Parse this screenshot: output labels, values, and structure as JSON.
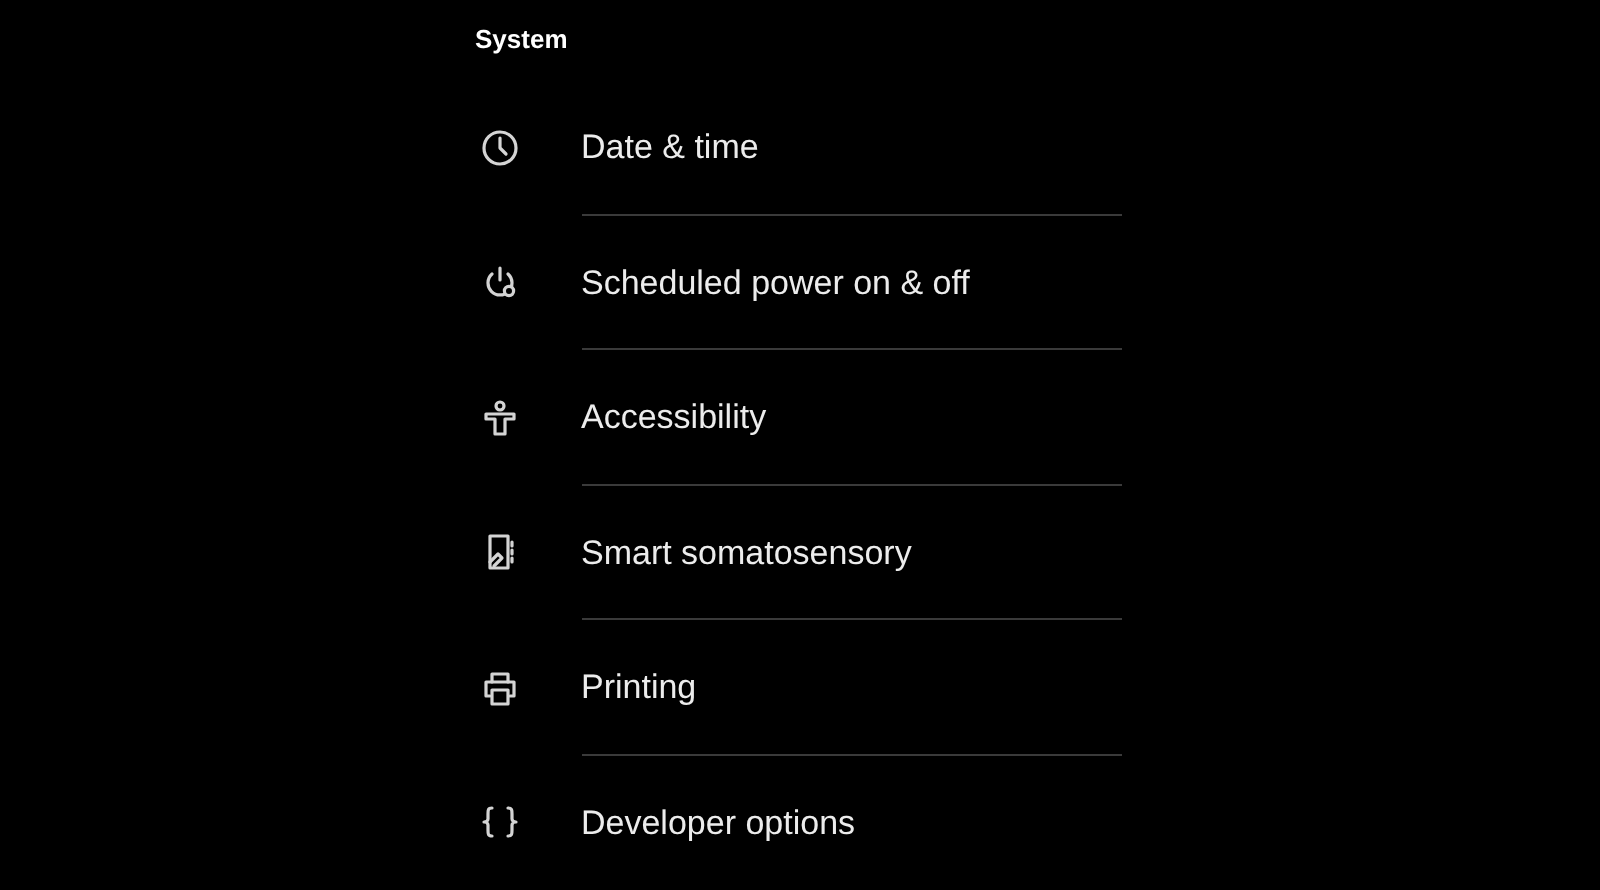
{
  "section_title": "System",
  "items": [
    {
      "label": "Date & time"
    },
    {
      "label": "Scheduled power on & off"
    },
    {
      "label": "Accessibility"
    },
    {
      "label": "Smart somatosensory"
    },
    {
      "label": "Printing"
    },
    {
      "label": "Developer options"
    }
  ]
}
